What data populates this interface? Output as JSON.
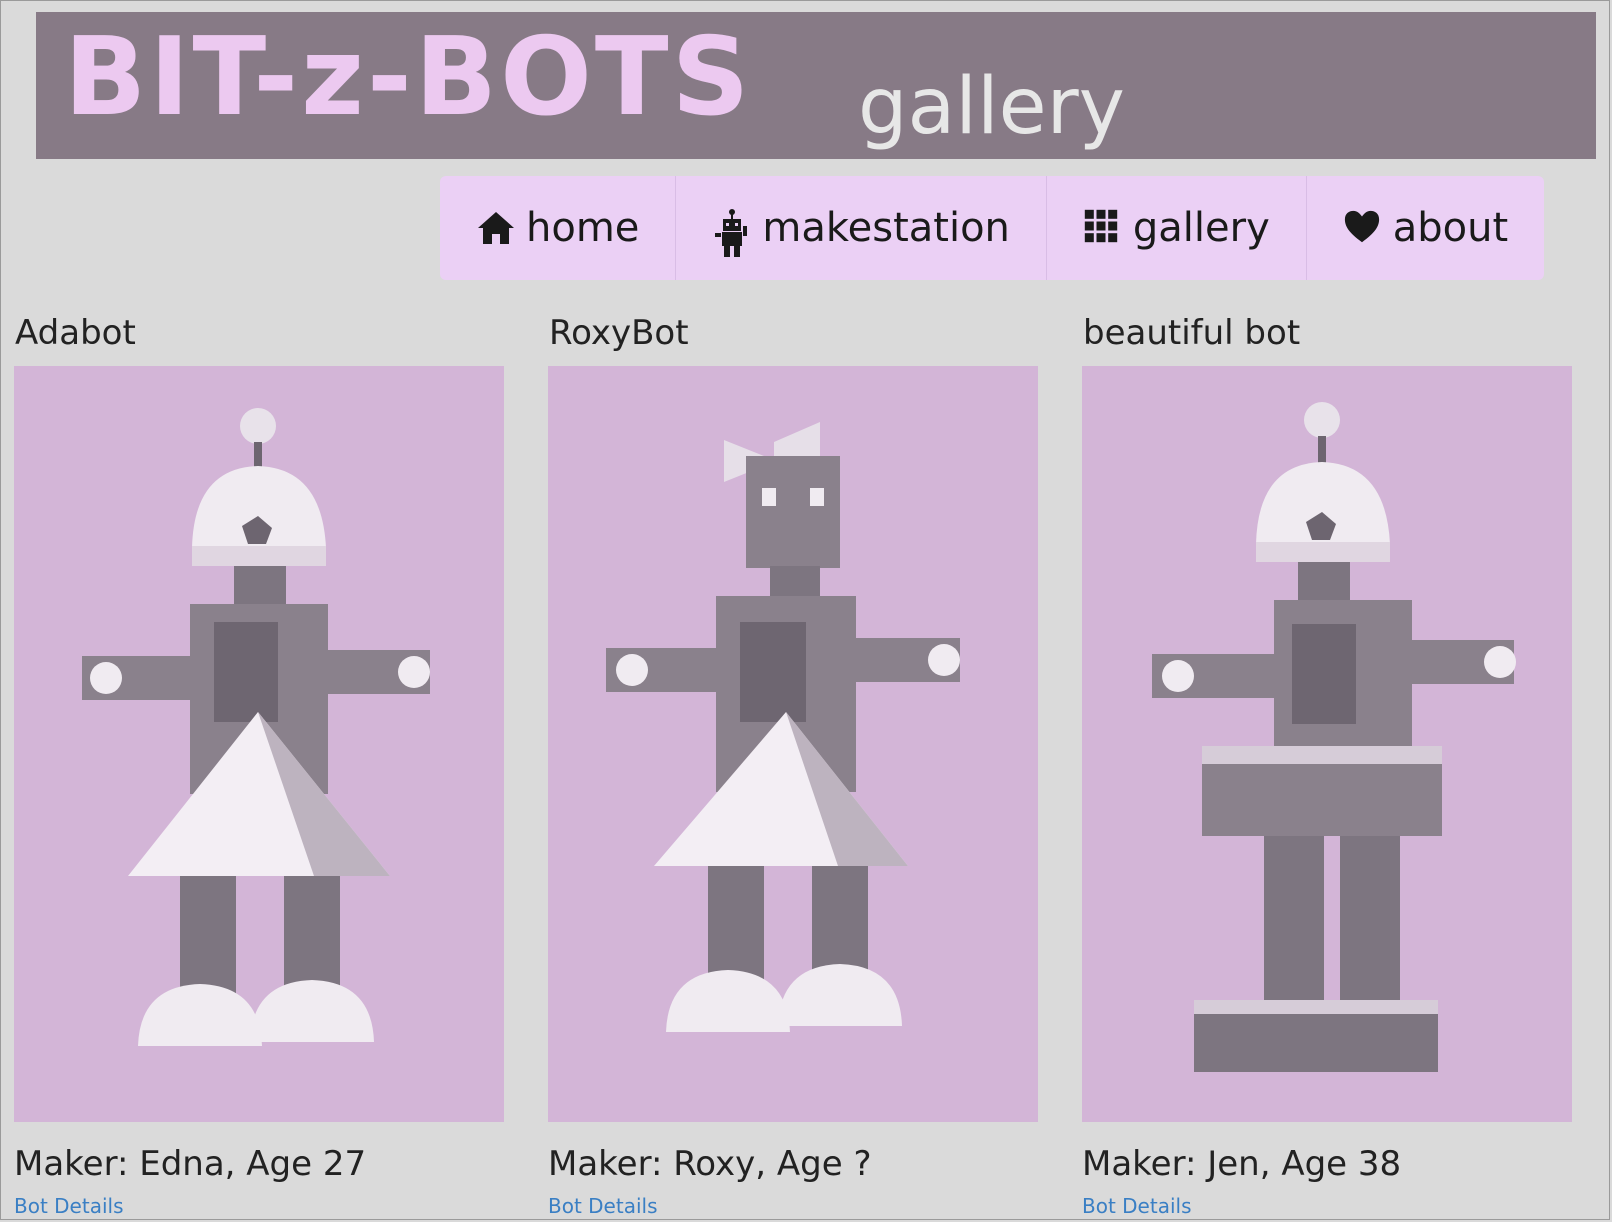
{
  "header": {
    "brand": "BIT-z-BOTS",
    "section": "gallery"
  },
  "nav": [
    {
      "label": "home",
      "icon": "home-icon"
    },
    {
      "label": "makestation",
      "icon": "robot-icon"
    },
    {
      "label": "gallery",
      "icon": "grid-icon"
    },
    {
      "label": "about",
      "icon": "heart-icon"
    }
  ],
  "cards": [
    {
      "title": "Adabot",
      "maker": "Maker: Edna, Age 27",
      "link": "Bot Details",
      "variant": "dress-dome"
    },
    {
      "title": "RoxyBot",
      "maker": "Maker: Roxy, Age ?",
      "link": "Bot Details",
      "variant": "dress-bow"
    },
    {
      "title": "beautiful bot",
      "maker": "Maker: Jen, Age 38",
      "link": "Bot Details",
      "variant": "skirt-dome"
    }
  ],
  "colors": {
    "banner": "#877a86",
    "brand": "#ecc9f0",
    "nav_bg": "#ebd0f5",
    "card_bg": "#d3b5d7",
    "link": "#3a7fc4"
  }
}
